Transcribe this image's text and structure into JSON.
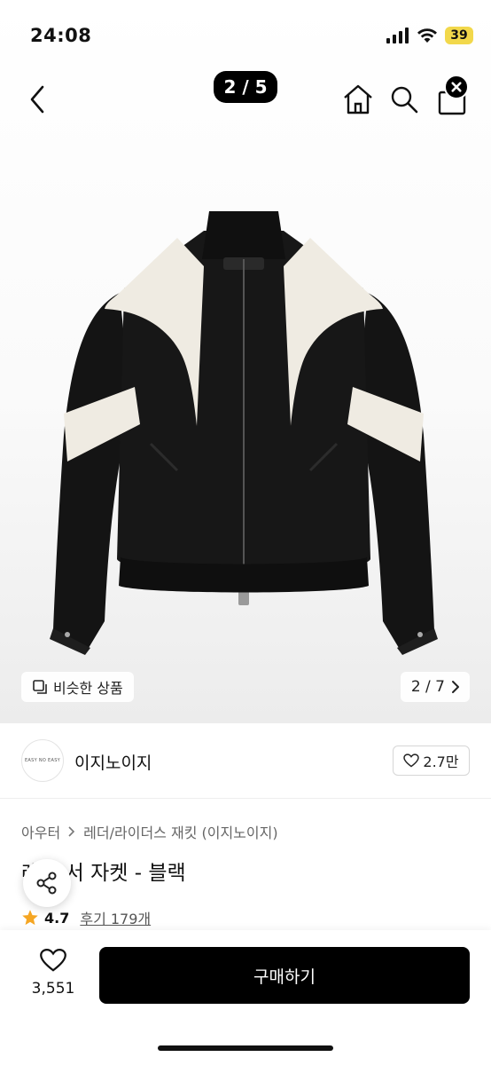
{
  "status_bar": {
    "time": "24:08",
    "battery": "39"
  },
  "gallery": {
    "page_indicator": "2 / 5",
    "similar_label": "비슷한 상품",
    "image_counter": "2 / 7"
  },
  "brand": {
    "logo_text": "EASY NO EASY",
    "name": "이지노이지",
    "like_count": "2.7만"
  },
  "product": {
    "breadcrumb": [
      "아우터",
      "레더/라이더스 재킷 (이지노이지)"
    ],
    "title": "레더 서 자켓 - 블랙",
    "rating": "4.7",
    "reviews": "후기 179개"
  },
  "bottom_bar": {
    "wish_count": "3,551",
    "buy_label": "구매하기"
  },
  "colors": {
    "accent_star": "#f5a623",
    "buy_button": "#000000",
    "battery": "#f2d84b"
  },
  "icons": [
    "back-icon",
    "home-icon",
    "search-icon",
    "bag-icon",
    "close-icon",
    "similar-icon",
    "chevron-right-icon",
    "heart-icon",
    "share-icon",
    "star-icon",
    "signal-icon",
    "wifi-icon"
  ]
}
